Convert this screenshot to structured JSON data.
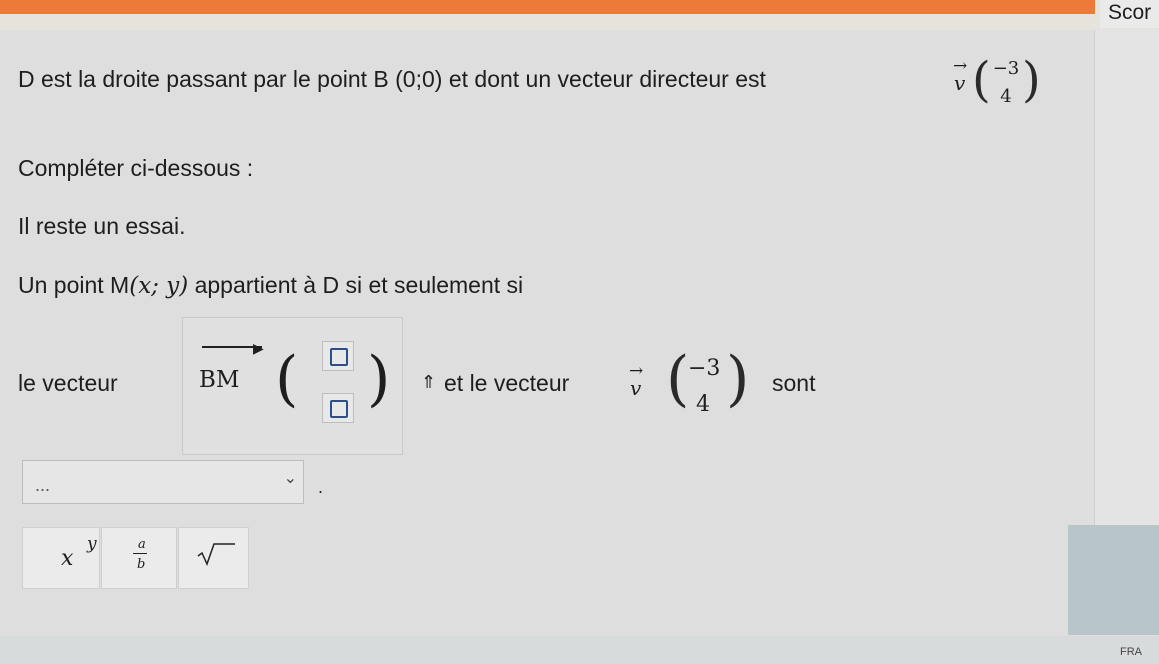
{
  "header": {
    "score_label": "Scor"
  },
  "problem": {
    "statement_pre": "D est la droite passant par le point B (0;0) et dont un vecteur directeur est",
    "vector_name": "v",
    "vector_arrow": "→",
    "vector_x": "−3",
    "vector_y": "4",
    "instruction": "Compléter ci-dessous :",
    "attempts": "Il reste un essai.",
    "point_pre": "Un point M",
    "point_coords": "(x; y)",
    "point_post": "appartient à D si et seulement si"
  },
  "answer_line": {
    "vec_label": "le vecteur",
    "bm_label": "BM",
    "input_x_value": "",
    "input_y_value": "",
    "up_arrow": "⇑",
    "middle_text": "et le vecteur",
    "v_x": "−3",
    "v_y": "4",
    "end_text": "sont"
  },
  "dropdown": {
    "selected": "...",
    "chevron": "⌄",
    "trailing": "."
  },
  "keyboard": {
    "power_base": "x",
    "power_exp": "y",
    "frac_num": "a",
    "frac_den": "b"
  },
  "footer": {
    "lang": "FRA"
  },
  "icons": [
    "chevron-down-icon",
    "square-root-icon",
    "up-arrow-icon"
  ]
}
